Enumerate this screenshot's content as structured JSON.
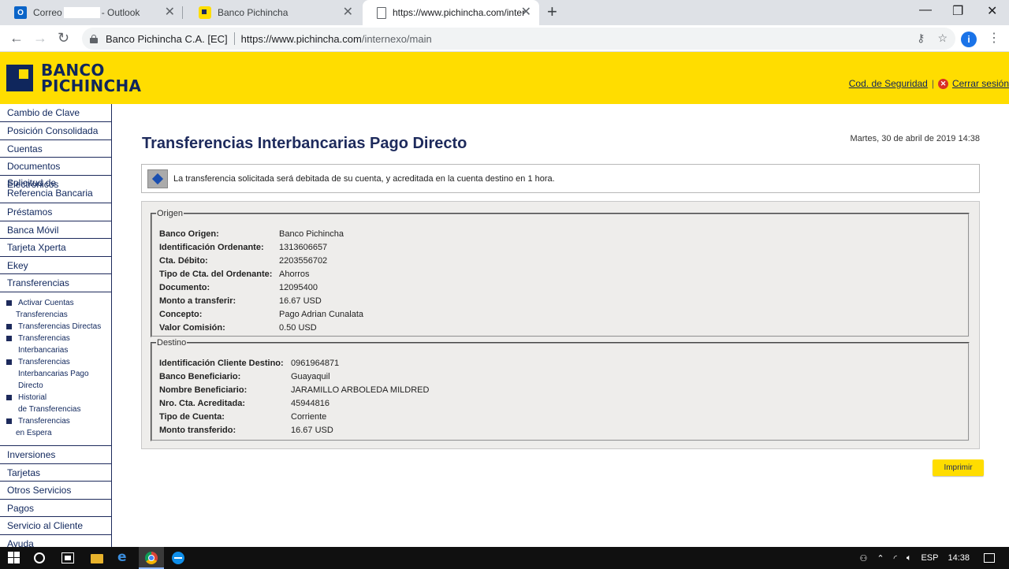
{
  "browser": {
    "tabs": [
      {
        "title_left": "Correo",
        "title_right": "- Outlook",
        "favicon": "outlook-icon",
        "active": false
      },
      {
        "title": "Banco Pichincha",
        "favicon": "banco-pichincha-icon",
        "active": false
      },
      {
        "title": "https://www.pichincha.com/inter",
        "favicon": "page-icon",
        "active": true
      }
    ],
    "new_tab": "+",
    "window_controls": {
      "minimize": "—",
      "maximize": "❐",
      "close": "✕"
    },
    "site_identity": "Banco Pichincha C.A. [EC]",
    "url_host": "https://www.pichincha.com",
    "url_path": "/internexo/main",
    "profile_initial": "i"
  },
  "header": {
    "logo_line1": "BANCO",
    "logo_line2": "PICHINCHA",
    "security_link": "Cod. de Seguridad",
    "separator": "|",
    "logout_link": "Cerrar sesión",
    "brand_yellow": "#ffdd00",
    "brand_navy": "#0f265c"
  },
  "nav": {
    "items_top": [
      "Cambio de Clave",
      "Posición Consolidada",
      "Cuentas",
      "Documentos Electrónicos"
    ],
    "item_two_line": {
      "line1": "Solicitud de",
      "line2": "Referencia Bancaria"
    },
    "items_mid": [
      "Préstamos",
      "Banca Móvil",
      "Tarjeta Xperta",
      "Ekey",
      "Transferencias"
    ],
    "sub_items": [
      {
        "line1": "Activar Cuentas",
        "line2": "Transferencias"
      },
      {
        "line1": "Transferencias Directas",
        "line2": ""
      },
      {
        "line1": "Transferencias",
        "line2": "Interbancarias"
      },
      {
        "line1": "Transferencias",
        "line2": "Interbancarias Pago",
        "line3": "Directo"
      },
      {
        "line1": "Historial",
        "line2": "de Transferencias"
      },
      {
        "line1": "Transferencias",
        "line2": "en Espera"
      }
    ],
    "items_bottom": [
      "Inversiones",
      "Tarjetas",
      "Otros Servicios",
      "Pagos",
      "Servicio al Cliente",
      "Ayuda"
    ]
  },
  "main": {
    "title": "Transferencias Interbancarias Pago Directo",
    "datetime": "Martes, 30 de abril de 2019 14:38",
    "info_message": "La transferencia solicitada será debitada de su cuenta, y acreditada en la cuenta destino en 1 hora.",
    "origen": {
      "legend": "Origen",
      "rows": [
        {
          "label": "Banco Origen:",
          "value": "Banco Pichincha"
        },
        {
          "label": "Identificación Ordenante:",
          "value": "1313606657"
        },
        {
          "label": "Cta. Débito:",
          "value": "2203556702"
        },
        {
          "label": "Tipo de Cta. del Ordenante:",
          "value": "Ahorros"
        },
        {
          "label": "Documento:",
          "value": "12095400"
        },
        {
          "label": "Monto a transferir:",
          "value": "16.67 USD"
        },
        {
          "label": "Concepto:",
          "value": "Pago Adrian Cunalata"
        },
        {
          "label": "Valor Comisión:",
          "value": "0.50 USD"
        }
      ]
    },
    "destino": {
      "legend": "Destino",
      "rows": [
        {
          "label": "Identificación Cliente Destino:",
          "value": "0961964871"
        },
        {
          "label": "Banco Beneficiario:",
          "value": "Guayaquil"
        },
        {
          "label": "Nombre Beneficiario:",
          "value": "JARAMILLO ARBOLEDA MILDRED"
        },
        {
          "label": "Nro. Cta. Acreditada:",
          "value": "45944816"
        },
        {
          "label": "Tipo de Cuenta:",
          "value": "Corriente"
        },
        {
          "label": "Monto transferido:",
          "value": "16.67 USD"
        }
      ]
    },
    "print_button": "Imprimir"
  },
  "taskbar": {
    "language": "ESP",
    "time": "14:38"
  }
}
